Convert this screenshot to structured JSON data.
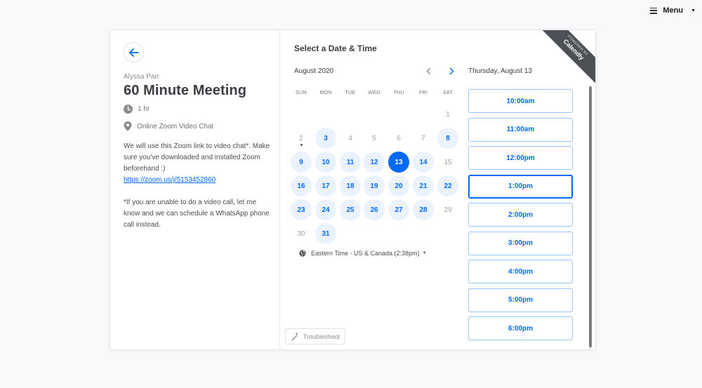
{
  "menu": {
    "label": "Menu"
  },
  "event": {
    "host": "Alyssa Parr",
    "title": "60 Minute Meeting",
    "duration": "1 hr",
    "location": "Online Zoom Video Chat",
    "description_1": "We will use this Zoom link to video chat*. Make sure you've downloaded and installed Zoom beforehand :)",
    "link": "https://zoom.us/j/5153452860",
    "description_2": "*If you are unable to do a video call, let me know and we can schedule a WhatsApp phone call instead."
  },
  "calendar": {
    "heading": "Select a Date & Time",
    "month": "August 2020",
    "weekdays": [
      "SUN",
      "MON",
      "TUE",
      "WED",
      "THU",
      "FRI",
      "SAT"
    ],
    "timezone": "Eastern Time - US & Canada (2:38pm)",
    "days": [
      {
        "d": "1",
        "s": "na"
      },
      {
        "d": "2",
        "s": "today"
      },
      {
        "d": "3",
        "s": "avail"
      },
      {
        "d": "4",
        "s": "na"
      },
      {
        "d": "5",
        "s": "na"
      },
      {
        "d": "6",
        "s": "na"
      },
      {
        "d": "7",
        "s": "na"
      },
      {
        "d": "8",
        "s": "avail"
      },
      {
        "d": "9",
        "s": "avail"
      },
      {
        "d": "10",
        "s": "avail"
      },
      {
        "d": "11",
        "s": "avail"
      },
      {
        "d": "12",
        "s": "avail"
      },
      {
        "d": "13",
        "s": "sel"
      },
      {
        "d": "14",
        "s": "avail"
      },
      {
        "d": "15",
        "s": "na"
      },
      {
        "d": "16",
        "s": "avail"
      },
      {
        "d": "17",
        "s": "avail"
      },
      {
        "d": "18",
        "s": "avail"
      },
      {
        "d": "19",
        "s": "avail"
      },
      {
        "d": "20",
        "s": "avail"
      },
      {
        "d": "21",
        "s": "avail"
      },
      {
        "d": "22",
        "s": "avail"
      },
      {
        "d": "23",
        "s": "avail"
      },
      {
        "d": "24",
        "s": "avail"
      },
      {
        "d": "25",
        "s": "avail"
      },
      {
        "d": "26",
        "s": "avail"
      },
      {
        "d": "27",
        "s": "avail"
      },
      {
        "d": "28",
        "s": "avail"
      },
      {
        "d": "29",
        "s": "na"
      },
      {
        "d": "30",
        "s": "na"
      },
      {
        "d": "31",
        "s": "avail"
      }
    ],
    "first_weekday": 6
  },
  "times": {
    "day_title": "Thursday, August 13",
    "slots": [
      "10:00am",
      "11:00am",
      "12:00pm",
      "1:00pm",
      "2:00pm",
      "3:00pm",
      "4:00pm",
      "5:00pm",
      "6:00pm"
    ],
    "active_index": 3
  },
  "troubleshoot": {
    "label": "Troubleshoot"
  },
  "ribbon": {
    "powered": "POWERED BY",
    "brand": "Calendly"
  },
  "colors": {
    "accent": "#0069ff",
    "available_bg": "#eaf3fd",
    "ribbon": "#4d5155"
  }
}
